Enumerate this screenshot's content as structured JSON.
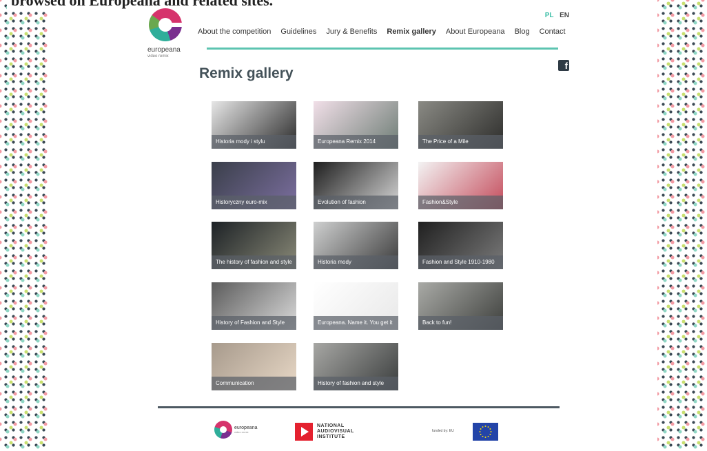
{
  "caption": "browsed on Europeana and related sites.",
  "logo": {
    "name": "europeana",
    "sub": "video remix"
  },
  "lang": {
    "pl": "PL",
    "en": "EN"
  },
  "nav": [
    {
      "label": "About the competition"
    },
    {
      "label": "Guidelines"
    },
    {
      "label": "Jury & Benefits"
    },
    {
      "label": "Remix gallery",
      "current": true
    },
    {
      "label": "About Europeana"
    },
    {
      "label": "Blog"
    },
    {
      "label": "Contact"
    }
  ],
  "social": {
    "facebook_icon": "facebook-icon"
  },
  "page_title": "Remix gallery",
  "gallery": [
    {
      "title": "Historia mody i stylu",
      "tone": [
        "#e6e6e6",
        "#2b2b2b"
      ]
    },
    {
      "title": "Europeana Remix 2014",
      "tone": [
        "#f1dfe8",
        "#6d7d75"
      ]
    },
    {
      "title": "The Price of a Mile",
      "tone": [
        "#8a8a84",
        "#2d2d2b"
      ]
    },
    {
      "title": "Historyczny euro-mix",
      "tone": [
        "#3a3f4a",
        "#7c6fa0"
      ]
    },
    {
      "title": "Evolution of fashion",
      "tone": [
        "#1e1e1e",
        "#d7d7d7"
      ]
    },
    {
      "title": "Fashion&Style",
      "tone": [
        "#f3f3f3",
        "#c44a5a"
      ]
    },
    {
      "title": "The history of fashion and style",
      "tone": [
        "#1d2226",
        "#8a8a78"
      ]
    },
    {
      "title": "Historia mody",
      "tone": [
        "#cfd0d0",
        "#3a3a3a"
      ]
    },
    {
      "title": "Fashion and Style 1910-1980",
      "tone": [
        "#202020",
        "#7b7b7b"
      ]
    },
    {
      "title": "History of Fashion and Style",
      "tone": [
        "#5c5c5c",
        "#dadada"
      ]
    },
    {
      "title": "Europeana. Name it. You get it",
      "tone": [
        "#ffffff",
        "#e8e8e8"
      ]
    },
    {
      "title": "Back to fun!",
      "tone": [
        "#a9aaa6",
        "#3e403d"
      ]
    },
    {
      "title": "Communication",
      "tone": [
        "#a79a8c",
        "#e8d8c6"
      ]
    },
    {
      "title": "History of fashion and style",
      "tone": [
        "#a7a7a4",
        "#3a3d3d"
      ]
    }
  ],
  "footer": {
    "europeana": "europeana",
    "europeana_sub": "video remix",
    "nai_lines": [
      "NATIONAL",
      "AUDIOVISUAL",
      "INSTITUTE"
    ],
    "funded": "funded by: EU"
  }
}
